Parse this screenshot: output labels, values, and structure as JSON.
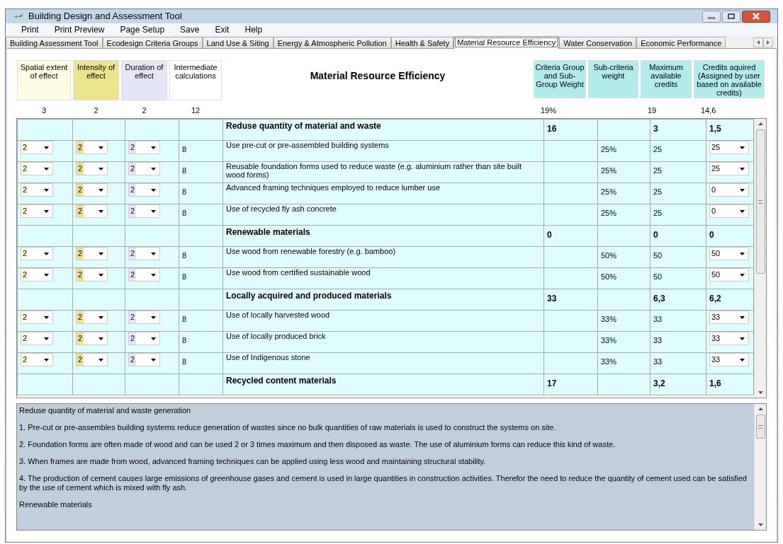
{
  "window": {
    "title": "Building Design and Assessment Tool"
  },
  "menu": [
    "Print",
    "Print Preview",
    "Page Setup",
    "Save",
    "Exit",
    "Help"
  ],
  "tabs": [
    {
      "label": "Building Assessment Tool",
      "selected": false
    },
    {
      "label": "Ecodesign Criteria Groups",
      "selected": false
    },
    {
      "label": "Land Use & Siting",
      "selected": false
    },
    {
      "label": "Energy & Atmospheric Pollution",
      "selected": false
    },
    {
      "label": "Health & Safety",
      "selected": false
    },
    {
      "label": "Material Resource Efficiency",
      "selected": true
    },
    {
      "label": "Water Conservation",
      "selected": false
    },
    {
      "label": "Economic Performance",
      "selected": false
    }
  ],
  "factors": [
    {
      "label": "Spatial extent of effect",
      "value": "3"
    },
    {
      "label": "Intensity of effect",
      "value": "2"
    },
    {
      "label": "Duration of effect",
      "value": "2"
    },
    {
      "label": "Intermediate calculations",
      "value": "12"
    }
  ],
  "title": "Material Resource Efficiency",
  "summary": [
    {
      "label": "Criteria Group and Sub-Group Weight",
      "value": "19%"
    },
    {
      "label": "Sub-criteria weight"
    },
    {
      "label": "Maximum available credits",
      "value": "19"
    },
    {
      "label": "Credits aquired (Assigned by user based on available credits)",
      "value": "14,6"
    }
  ],
  "rows": [
    {
      "kind": "group",
      "name": "Reduse quantity of material and waste",
      "weight": "16",
      "max": "3",
      "credits": "1,5"
    },
    {
      "kind": "item",
      "spatial": "2",
      "intensity": "2",
      "duration": "2",
      "intermediate": "8",
      "name": "Use pre-cut or pre-assembled building systems",
      "sub_weight": "25%",
      "max": "25",
      "credits": "25"
    },
    {
      "kind": "item",
      "spatial": "2",
      "intensity": "2",
      "duration": "2",
      "intermediate": "8",
      "name": "Reusable foundation forms used to reduce waste (e.g. aluminium rather than site built wood forms)",
      "sub_weight": "25%",
      "max": "25",
      "credits": "25"
    },
    {
      "kind": "item",
      "spatial": "2",
      "intensity": "2",
      "duration": "2",
      "intermediate": "8",
      "name": "Advanced framing techniques employed to reduce lumber use",
      "sub_weight": "25%",
      "max": "25",
      "credits": "0"
    },
    {
      "kind": "item",
      "spatial": "2",
      "intensity": "2",
      "duration": "2",
      "intermediate": "8",
      "name": "Use of recycled fly ash concrete",
      "sub_weight": "25%",
      "max": "25",
      "credits": "0"
    },
    {
      "kind": "group",
      "name": "Renewable materials",
      "weight": "0",
      "max": "0",
      "credits": "0"
    },
    {
      "kind": "item",
      "spatial": "2",
      "intensity": "2",
      "duration": "2",
      "intermediate": "8",
      "name": "Use wood from renewable forestry (e.g. bamboo)",
      "sub_weight": "50%",
      "max": "50",
      "credits": "50"
    },
    {
      "kind": "item",
      "spatial": "2",
      "intensity": "2",
      "duration": "2",
      "intermediate": "8",
      "name": "Use wood from certified sustainable wood",
      "sub_weight": "50%",
      "max": "50",
      "credits": "50"
    },
    {
      "kind": "group",
      "name": "Locally acquired and produced materials",
      "weight": "33",
      "max": "6,3",
      "credits": "6,2"
    },
    {
      "kind": "item",
      "spatial": "2",
      "intensity": "2",
      "duration": "2",
      "intermediate": "8",
      "name": "Use of locally harvested wood",
      "sub_weight": "33%",
      "max": "33",
      "credits": "33"
    },
    {
      "kind": "item",
      "spatial": "2",
      "intensity": "2",
      "duration": "2",
      "intermediate": "8",
      "name": "Use of locally produced brick",
      "sub_weight": "33%",
      "max": "33",
      "credits": "33"
    },
    {
      "kind": "item",
      "spatial": "2",
      "intensity": "2",
      "duration": "2",
      "intermediate": "8",
      "name": "Use of Indigenous stone",
      "sub_weight": "33%",
      "max": "33",
      "credits": "33"
    },
    {
      "kind": "group",
      "name": "Recycled content materials",
      "weight": "17",
      "max": "3,2",
      "credits": "1,6"
    }
  ],
  "notes": [
    "Reduse quantity of material and waste generation",
    "1. Pre-cut or pre-assembles building systems reduce generation of wastes since no bulk quantities of raw materials is used to construct the systems on site.",
    "2. Foundation forms are often made of wood and can be used 2 or 3 times maximum and then disposed as waste. The use of aluminium forms can reduce this kind of waste.",
    "3. When frames are made from wood, advanced framing techniques can be applied using less wood and maintaining structural stability.",
    "4. The production of cement causes large emissions of greenhouse gases and cement is used in large quantities in construction activities. Therefor the need to reduce the quantity of cement used can be satisfied by the use of cement which is mixed with fly ash.",
    "Renewable materials"
  ]
}
